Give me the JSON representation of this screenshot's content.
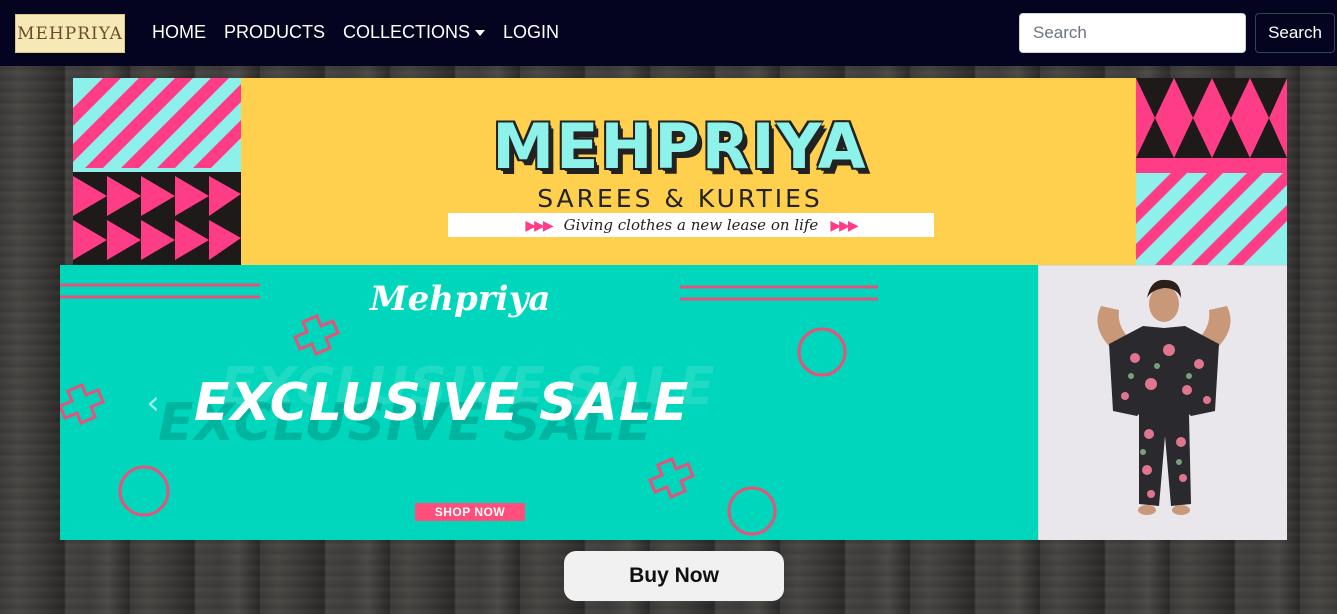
{
  "brand": {
    "logo_text": "MEHPRIYA"
  },
  "nav": {
    "items": [
      {
        "label": "HOME"
      },
      {
        "label": "PRODUCTS"
      },
      {
        "label": "COLLECTIONS",
        "has_dropdown": true
      },
      {
        "label": "LOGIN"
      }
    ]
  },
  "search": {
    "placeholder": "Search",
    "button_label": "Search"
  },
  "banner": {
    "title": "MEHPRIYA",
    "subtitle": "SAREES & KURTIES",
    "tagline": "Giving clothes a new lease on life",
    "tagline_arrows": "▶▶▶",
    "colors": {
      "background": "#ffd04d",
      "accent_pink": "#ff3d86",
      "accent_cyan": "#8df3ea"
    }
  },
  "hero": {
    "script_title": "Mehpriya",
    "headline": "EXCLUSIVE SALE",
    "cta": "SHOP NOW",
    "prev_icon": "chevron-left-icon",
    "colors": {
      "background": "#00d6bc",
      "accent": "#e6537a"
    }
  },
  "buy_now_label": "Buy Now"
}
